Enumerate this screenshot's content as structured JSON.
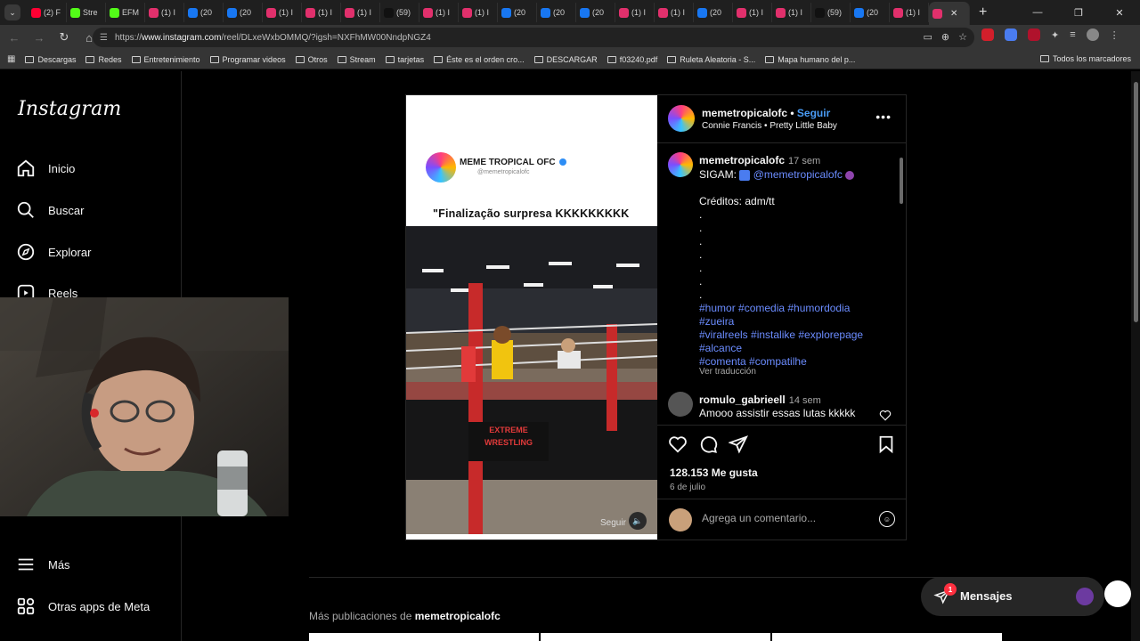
{
  "browser": {
    "tab_menu": "⌄",
    "tabs": [
      {
        "label": "(2) F",
        "color": "#ff0033"
      },
      {
        "label": "Stre",
        "color": "#53fc18"
      },
      {
        "label": "EFM",
        "color": "#53fc18"
      },
      {
        "label": "(1) I",
        "color": "#e1306c"
      },
      {
        "label": "(20",
        "color": "#1877f2"
      },
      {
        "label": "(20",
        "color": "#1877f2"
      },
      {
        "label": "(1) I",
        "color": "#e1306c"
      },
      {
        "label": "(1) I",
        "color": "#e1306c"
      },
      {
        "label": "(1) I",
        "color": "#e1306c"
      },
      {
        "label": "(59)",
        "color": "#111111"
      },
      {
        "label": "(1) I",
        "color": "#e1306c"
      },
      {
        "label": "(1) I",
        "color": "#e1306c"
      },
      {
        "label": "(20",
        "color": "#1877f2"
      },
      {
        "label": "(20",
        "color": "#1877f2"
      },
      {
        "label": "(20",
        "color": "#1877f2"
      },
      {
        "label": "(1) I",
        "color": "#e1306c"
      },
      {
        "label": "(1) I",
        "color": "#e1306c"
      },
      {
        "label": "(20",
        "color": "#1877f2"
      },
      {
        "label": "(1) I",
        "color": "#e1306c"
      },
      {
        "label": "(1) I",
        "color": "#e1306c"
      },
      {
        "label": "(59)",
        "color": "#111111"
      },
      {
        "label": "(20",
        "color": "#1877f2"
      },
      {
        "label": "(1) I",
        "color": "#e1306c"
      }
    ],
    "url_prefix": "https://",
    "url_host": "www.instagram.com",
    "url_path": "/reel/DLxeWxbOMMQ/?igsh=NXFhMW00NndpNGZ4",
    "bookmarks": [
      "Descargas",
      "Redes",
      "Entretenimiento",
      "Programar videos",
      "Otros",
      "Stream",
      "tarjetas",
      "Éste es el orden cro...",
      "DESCARGAR",
      "f03240.pdf",
      "Ruleta Aleatoria - S...",
      "Mapa humano del p..."
    ],
    "bookmarks_right": "Todos los marcadores"
  },
  "sidebar": {
    "logo": "Instagram",
    "items": [
      "Inicio",
      "Buscar",
      "Explorar",
      "Reels"
    ],
    "more": "Más",
    "meta_apps": "Otras apps de Meta"
  },
  "post": {
    "media": {
      "brand": "MEME TROPICAL OFC",
      "handle": "@memetropicalofc",
      "caption": "\"Finalização surpresa KKKKKKKKK",
      "follow_overlay": "Seguir",
      "apron_top": "EXTREME",
      "apron_bottom": "WRESTLING"
    },
    "header": {
      "username": "memetropicalofc",
      "follow": "Seguir",
      "song_artist": "Connie Francis",
      "song_title": "Pretty Little Baby"
    },
    "caption": {
      "username": "memetropicalofc",
      "time": "17 sem",
      "line1_prefix": "SIGAM: ",
      "mention": "@memetropicalofc",
      "credits": "Créditos: adm/tt",
      "dot": ".",
      "hashtag_lines": [
        "#humor #comedia #humordodia",
        "#zueira",
        "#viralreels #instalike #explorepage",
        "#alcance",
        "#comenta #compatilhe"
      ],
      "see_translation": "Ver traducción"
    },
    "comment": {
      "username": "romulo_gabrieell",
      "time": "14 sem",
      "text": "Amooo assistir essas lutas kkkkk"
    },
    "likes": "128.153 Me gusta",
    "date": "6 de julio",
    "comment_placeholder": "Agrega un comentario..."
  },
  "more_posts": {
    "prefix": "Más publicaciones de ",
    "username": "memetropicalofc"
  },
  "messages": {
    "label": "Mensajes",
    "badge": "1"
  }
}
